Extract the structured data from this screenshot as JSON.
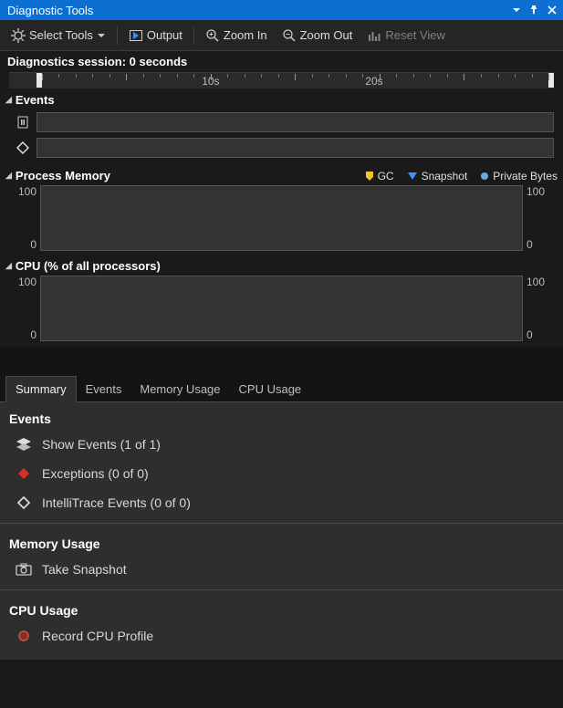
{
  "title": "Diagnostic Tools",
  "toolbar": {
    "select_tools": "Select Tools",
    "output": "Output",
    "zoom_in": "Zoom In",
    "zoom_out": "Zoom Out",
    "reset_view": "Reset View"
  },
  "session_label": "Diagnostics session: 0 seconds",
  "timeline": {
    "labels": [
      "10s",
      "20s"
    ]
  },
  "events_section": {
    "title": "Events"
  },
  "process_memory": {
    "title": "Process Memory",
    "legend": {
      "gc": "GC",
      "snapshot": "Snapshot",
      "private_bytes": "Private Bytes"
    },
    "ymax": "100",
    "ymin": "0"
  },
  "cpu": {
    "title": "CPU (% of all processors)",
    "ymax": "100",
    "ymin": "0"
  },
  "tabs": {
    "summary": "Summary",
    "events": "Events",
    "memory_usage": "Memory Usage",
    "cpu_usage": "CPU Usage"
  },
  "summary_panel": {
    "events_heading": "Events",
    "show_events": "Show Events (1 of 1)",
    "exceptions": "Exceptions (0 of 0)",
    "intellitrace": "IntelliTrace Events (0 of 0)",
    "memory_heading": "Memory Usage",
    "take_snapshot": "Take Snapshot",
    "cpu_heading": "CPU Usage",
    "record_cpu": "Record CPU Profile"
  },
  "chart_data": [
    {
      "type": "line",
      "title": "Process Memory",
      "series": [
        {
          "name": "Private Bytes",
          "values": []
        }
      ],
      "x": [],
      "xlabel": "",
      "ylabel": "",
      "ylim": [
        0,
        100
      ],
      "legend": [
        "GC",
        "Snapshot",
        "Private Bytes"
      ]
    },
    {
      "type": "line",
      "title": "CPU (% of all processors)",
      "series": [
        {
          "name": "CPU",
          "values": []
        }
      ],
      "x": [],
      "xlabel": "",
      "ylabel": "",
      "ylim": [
        0,
        100
      ]
    }
  ]
}
